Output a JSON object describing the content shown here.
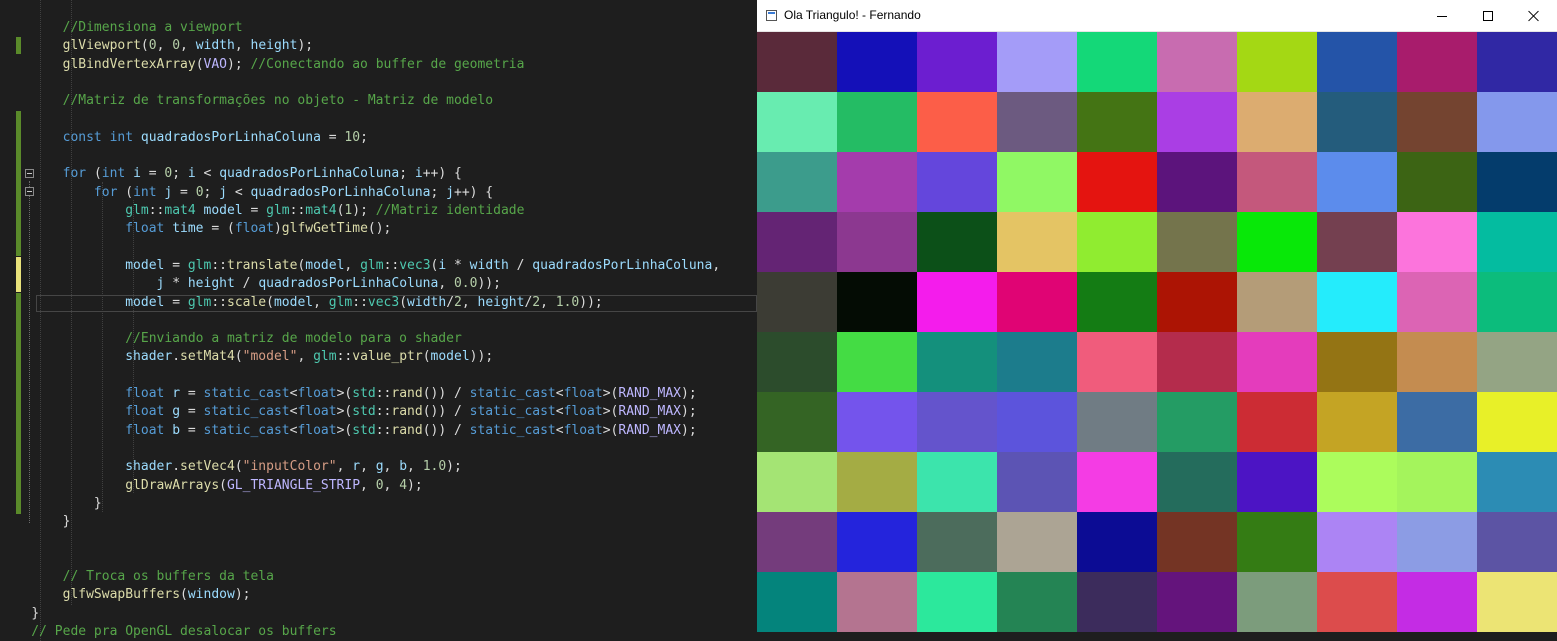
{
  "editor": {
    "lines": [
      {
        "t": "        //Dimensiona a viewport",
        "c": "cm"
      },
      {
        "t": "        glViewport(0, 0, width, height);",
        "c": "code"
      },
      {
        "t": "        glBindVertexArray(VAO); //Conectando ao buffer de geometria",
        "c": "code"
      },
      {
        "t": "",
        "c": "blank"
      },
      {
        "t": "        //Matriz de transformações no objeto - Matriz de modelo",
        "c": "cm"
      },
      {
        "t": "",
        "c": "blank"
      },
      {
        "t": "        const int quadradosPorLinhaColuna = 10;",
        "c": "code"
      },
      {
        "t": "",
        "c": "blank"
      },
      {
        "t": "        for (int i = 0; i < quadradosPorLinhaColuna; i++) {",
        "c": "code"
      },
      {
        "t": "            for (int j = 0; j < quadradosPorLinhaColuna; j++) {",
        "c": "code"
      },
      {
        "t": "                glm::mat4 model = glm::mat4(1); //Matriz identidade",
        "c": "code"
      },
      {
        "t": "                float time = (float)glfwGetTime();",
        "c": "code"
      },
      {
        "t": "",
        "c": "blank"
      },
      {
        "t": "                model = glm::translate(model, glm::vec3(i * width / quadradosPorLinhaColuna,",
        "c": "code"
      },
      {
        "t": "                    j * height / quadradosPorLinhaColuna, 0.0));",
        "c": "code"
      },
      {
        "t": "                model = glm::scale(model, glm::vec3(width/2, height/2, 1.0));",
        "c": "code"
      },
      {
        "t": "",
        "c": "blank"
      },
      {
        "t": "                //Enviando a matriz de modelo para o shader",
        "c": "cm"
      },
      {
        "t": "                shader.setMat4(\"model\", glm::value_ptr(model));",
        "c": "code"
      },
      {
        "t": "",
        "c": "blank"
      },
      {
        "t": "                float r = static_cast<float>(std::rand()) / static_cast<float>(RAND_MAX);",
        "c": "code"
      },
      {
        "t": "                float g = static_cast<float>(std::rand()) / static_cast<float>(RAND_MAX);",
        "c": "code"
      },
      {
        "t": "                float b = static_cast<float>(std::rand()) / static_cast<float>(RAND_MAX);",
        "c": "code"
      },
      {
        "t": "",
        "c": "blank"
      },
      {
        "t": "                shader.setVec4(\"inputColor\", r, g, b, 1.0);",
        "c": "code"
      },
      {
        "t": "                glDrawArrays(GL_TRIANGLE_STRIP, 0, 4);",
        "c": "code"
      },
      {
        "t": "            }",
        "c": "code"
      },
      {
        "t": "        }",
        "c": "code"
      },
      {
        "t": "",
        "c": "blank"
      },
      {
        "t": "",
        "c": "blank"
      },
      {
        "t": "        // Troca os buffers da tela",
        "c": "cm"
      },
      {
        "t": "        glfwSwapBuffers(window);",
        "c": "code"
      },
      {
        "t": "    }",
        "c": "code"
      },
      {
        "t": "    // Pede pra OpenGL desalocar os buffers",
        "c": "cm"
      }
    ]
  },
  "window": {
    "title": "Ola Triangulo! - Fernando",
    "app_icon": "window-app-icon",
    "controls": [
      "minimize-icon",
      "maximize-icon",
      "close-icon"
    ]
  },
  "grid_colors": [
    [
      "#5a2a3a",
      "#1410b8",
      "#6c1ed0",
      "#a49cf8",
      "#14d878",
      "#c86cb0",
      "#a4d814",
      "#2454a8",
      "#a81c6c",
      "#3028a4"
    ],
    [
      "#68ecb0",
      "#24bc64",
      "#fc5e48",
      "#6c5a80",
      "#447414",
      "#aa3ee4",
      "#dcac70",
      "#245c7c",
      "#744430",
      "#8498ec"
    ],
    [
      "#3c9c8c",
      "#a43cac",
      "#6446dc",
      "#90f864",
      "#e41410",
      "#5c147c",
      "#c4587c",
      "#5c8cec",
      "#3c6414",
      "#043c6c"
    ],
    [
      "#642474",
      "#8c3890",
      "#0c5018",
      "#e4c464",
      "#90ec30",
      "#74744c",
      "#08e808",
      "#744050",
      "#fc74dc",
      "#04bca0"
    ],
    [
      "#3c3c34",
      "#040c04",
      "#f41cec",
      "#e00474",
      "#147c14",
      "#ac1404",
      "#b49c78",
      "#24ecfc",
      "#dc64b4",
      "#0cbc7c"
    ],
    [
      "#2c4c2c",
      "#44dc44",
      "#14907c",
      "#1c7c8c",
      "#f05c7c",
      "#b42c4c",
      "#e43cbc",
      "#947414",
      "#c48c50",
      "#94a484"
    ],
    [
      "#346424",
      "#7454ec",
      "#6454cc",
      "#5c54dc",
      "#707c84",
      "#249c64",
      "#cc2c34",
      "#c4a424",
      "#3c6ca4",
      "#e8f028"
    ],
    [
      "#a4e474",
      "#a4ac44",
      "#3ce4ac",
      "#5c54b4",
      "#f43ce4",
      "#246c5c",
      "#4c14c4",
      "#acfc5c",
      "#a4f45c",
      "#2c8cb4"
    ],
    [
      "#743c7c",
      "#2424dc",
      "#4c6c5c",
      "#aca494",
      "#0c0c94",
      "#743424",
      "#347c14",
      "#ac84f4",
      "#8c9ce4",
      "#5c54a4"
    ],
    [
      "#04847c",
      "#b47490",
      "#2ce89c",
      "#248454",
      "#3c2c5c",
      "#64147c",
      "#7c9c7c",
      "#dc4c4c",
      "#c42ce4",
      "#ece474"
    ]
  ]
}
